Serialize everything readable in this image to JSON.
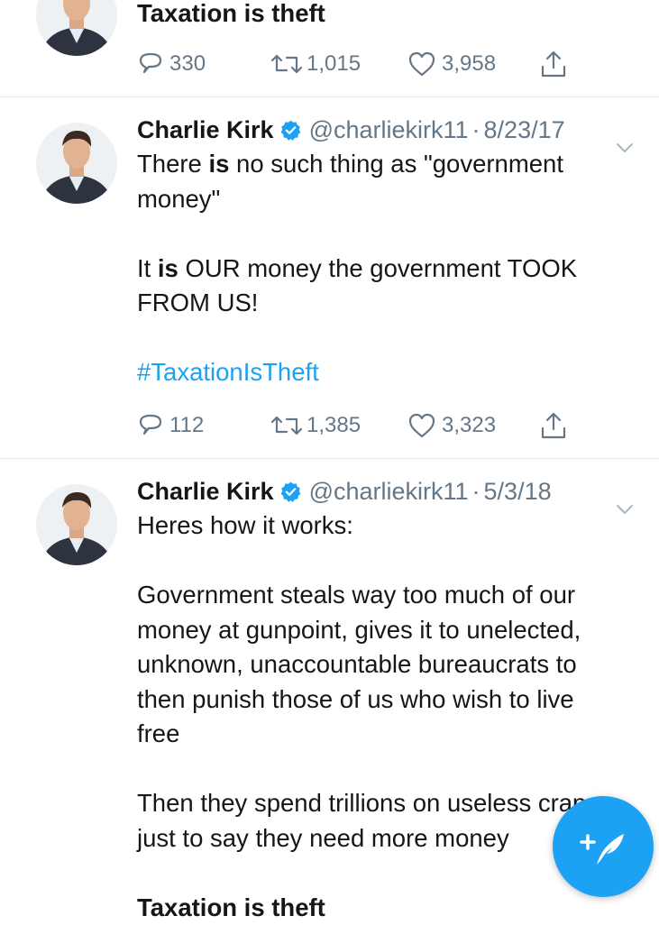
{
  "tweet1": {
    "tail_text": "Taxation is theft",
    "replies": "330",
    "retweets": "1,015",
    "likes": "3,958"
  },
  "tweet2": {
    "name": "Charlie Kirk",
    "handle": "@charliekirk11",
    "separator": "·",
    "date": "8/23/17",
    "text_line1_a": "There ",
    "text_line1_bold": "is",
    "text_line1_b": " no such thing as \"government",
    "text_line2": "money\"",
    "text_line3_a": "It ",
    "text_line3_bold": "is",
    "text_line3_b": " OUR money the government TOOK",
    "text_line4": "FROM US!",
    "hashtag": "#TaxationIsTheft",
    "replies": "112",
    "retweets": "1,385",
    "likes": "3,323"
  },
  "tweet3": {
    "name": "Charlie Kirk",
    "handle": "@charliekirk11",
    "separator": "·",
    "date": "5/3/18",
    "para1": "Heres how it works:",
    "para2_lines": [
      "Government steals way too much of our",
      "money at gunpoint, gives it to unelected,",
      "unknown, unaccountable bureaucrats to",
      "then punish those of us who wish to live",
      "free"
    ],
    "para3_lines": [
      "Then they spend trillions on useless crap",
      "just to say they need more money"
    ],
    "para4": "Taxation is theft"
  },
  "colors": {
    "link_blue": "#1da1f2",
    "secondary_gray": "#657786",
    "divider": "#e1e8ed"
  },
  "icons": {
    "reply": "reply-icon",
    "retweet": "retweet-icon",
    "like": "heart-icon",
    "share": "share-icon",
    "verified": "verified-badge-icon",
    "caret": "chevron-down-icon",
    "compose": "compose-tweet-icon"
  }
}
